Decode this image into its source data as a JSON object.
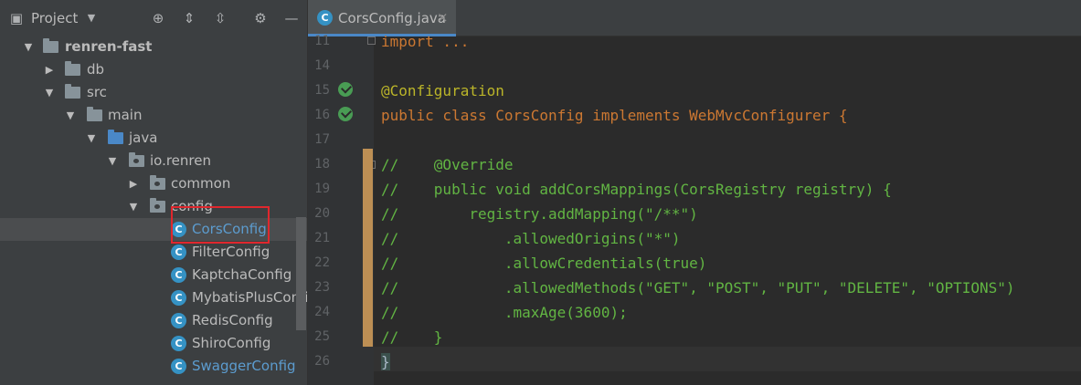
{
  "project_panel": {
    "title": "Project",
    "tree": [
      {
        "label": "renren-fast",
        "type": "module",
        "expanded": true
      },
      {
        "label": "db",
        "type": "folder",
        "expanded": false
      },
      {
        "label": "src",
        "type": "folder",
        "expanded": true
      },
      {
        "label": "main",
        "type": "folder",
        "expanded": true
      },
      {
        "label": "java",
        "type": "source-folder",
        "expanded": true
      },
      {
        "label": "io.renren",
        "type": "package",
        "expanded": true
      },
      {
        "label": "common",
        "type": "package",
        "expanded": false
      },
      {
        "label": "config",
        "type": "package",
        "expanded": true
      },
      {
        "label": "CorsConfig",
        "type": "class",
        "selected": true
      },
      {
        "label": "FilterConfig",
        "type": "class"
      },
      {
        "label": "KaptchaConfig",
        "type": "class"
      },
      {
        "label": "MybatisPlusConfig",
        "type": "class"
      },
      {
        "label": "RedisConfig",
        "type": "class"
      },
      {
        "label": "ShiroConfig",
        "type": "class"
      },
      {
        "label": "SwaggerConfig",
        "type": "class",
        "modified": true
      }
    ]
  },
  "editor": {
    "tab": {
      "label": "CorsConfig.java",
      "close": "×",
      "icon_letter": "C"
    },
    "lines": [
      {
        "num": "11",
        "text": "import ..."
      },
      {
        "num": "14",
        "text": ""
      },
      {
        "num": "15",
        "text": "@Configuration"
      },
      {
        "num": "16",
        "text": "public class CorsConfig implements WebMvcConfigurer {"
      },
      {
        "num": "17",
        "text": ""
      },
      {
        "num": "18",
        "text": "//    @Override"
      },
      {
        "num": "19",
        "text": "//    public void addCorsMappings(CorsRegistry registry) {"
      },
      {
        "num": "20",
        "text": "//        registry.addMapping(\"/**\")"
      },
      {
        "num": "21",
        "text": "//            .allowedOrigins(\"*\")"
      },
      {
        "num": "22",
        "text": "//            .allowCredentials(true)"
      },
      {
        "num": "23",
        "text": "//            .allowedMethods(\"GET\", \"POST\", \"PUT\", \"DELETE\", \"OPTIONS\")"
      },
      {
        "num": "24",
        "text": "//            .maxAge(3600);"
      },
      {
        "num": "25",
        "text": "//    }"
      },
      {
        "num": "26",
        "text": "}"
      }
    ]
  },
  "colors": {
    "keyword": "#cc7832",
    "annotation": "#bbb529",
    "comment": "#629755",
    "selection_box": "#e0272d",
    "tab_underline": "#4a88c7"
  }
}
